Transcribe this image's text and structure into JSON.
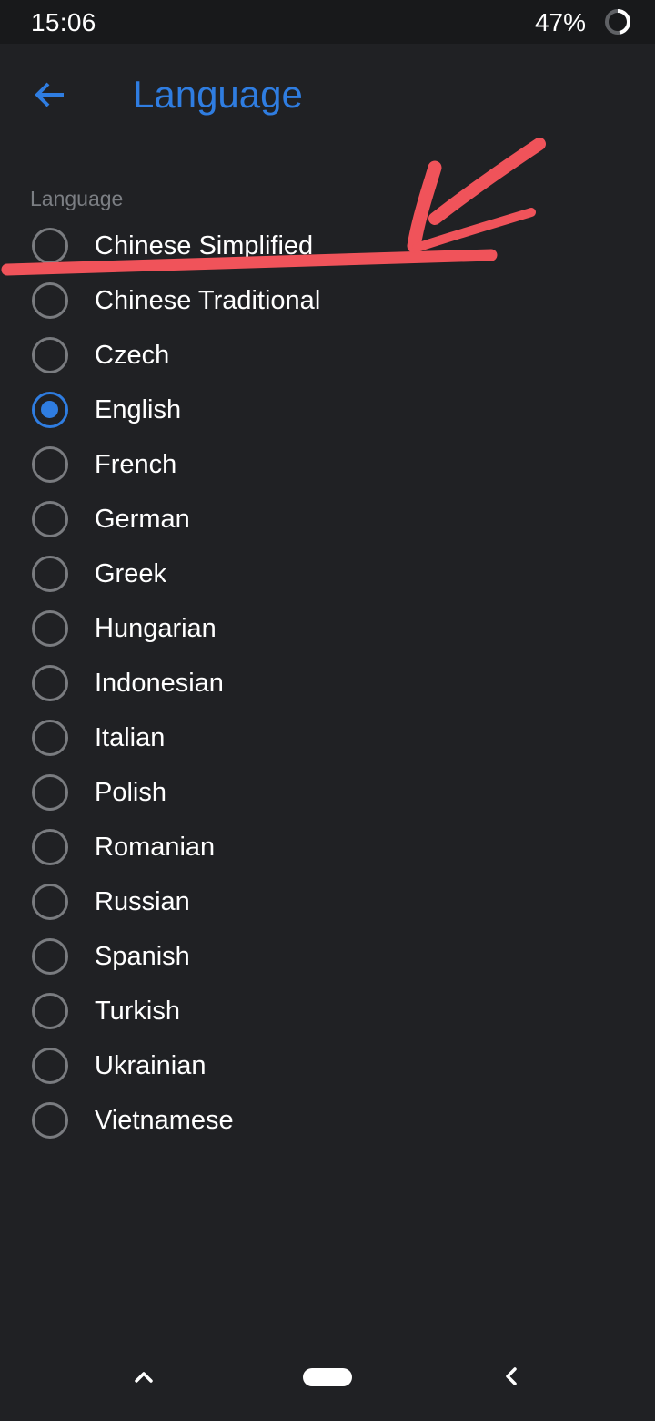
{
  "status_bar": {
    "time": "15:06",
    "battery": "47%"
  },
  "app_bar": {
    "title": "Language",
    "back_icon": "arrow-left-icon"
  },
  "section": {
    "header": "Language"
  },
  "languages": [
    {
      "label": "Chinese Simplified",
      "checked": false
    },
    {
      "label": "Chinese Traditional",
      "checked": false
    },
    {
      "label": "Czech",
      "checked": false
    },
    {
      "label": "English",
      "checked": true
    },
    {
      "label": "French",
      "checked": false
    },
    {
      "label": "German",
      "checked": false
    },
    {
      "label": "Greek",
      "checked": false
    },
    {
      "label": "Hungarian",
      "checked": false
    },
    {
      "label": "Indonesian",
      "checked": false
    },
    {
      "label": "Italian",
      "checked": false
    },
    {
      "label": "Polish",
      "checked": false
    },
    {
      "label": "Romanian",
      "checked": false
    },
    {
      "label": "Russian",
      "checked": false
    },
    {
      "label": "Spanish",
      "checked": false
    },
    {
      "label": "Turkish",
      "checked": false
    },
    {
      "label": "Ukrainian",
      "checked": false
    },
    {
      "label": "Vietnamese",
      "checked": false
    }
  ],
  "colors": {
    "background": "#202124",
    "accent": "#2f7de1",
    "annotation": "#f0535a"
  },
  "nav_bar": {
    "icons": [
      "chevron-up-icon",
      "home-pill-icon",
      "chevron-back-icon"
    ]
  }
}
